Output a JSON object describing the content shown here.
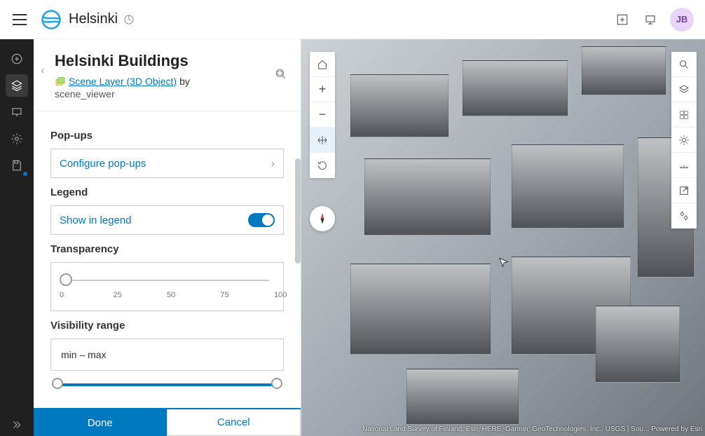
{
  "header": {
    "app_title": "Helsinki",
    "avatar_initials": "JB"
  },
  "panel": {
    "layer_title": "Helsinki Buildings",
    "layer_type_link": "Scene Layer (3D Object)",
    "by_word": "by",
    "owner": "scene_viewer",
    "sections": {
      "popups_label": "Pop-ups",
      "configure_popups": "Configure pop-ups",
      "legend_label": "Legend",
      "show_in_legend": "Show in legend",
      "transparency_label": "Transparency",
      "transparency_ticks": [
        "0",
        "25",
        "50",
        "75",
        "100"
      ],
      "visibility_label": "Visibility range",
      "visibility_text": "min  –  max"
    },
    "footer": {
      "done": "Done",
      "cancel": "Cancel"
    }
  },
  "map": {
    "attribution": "National Land Survey of Finland, Esri, HERE, Garmin, GeoTechnologies, Inc., USGS | Sou...   Powered by Esri"
  }
}
